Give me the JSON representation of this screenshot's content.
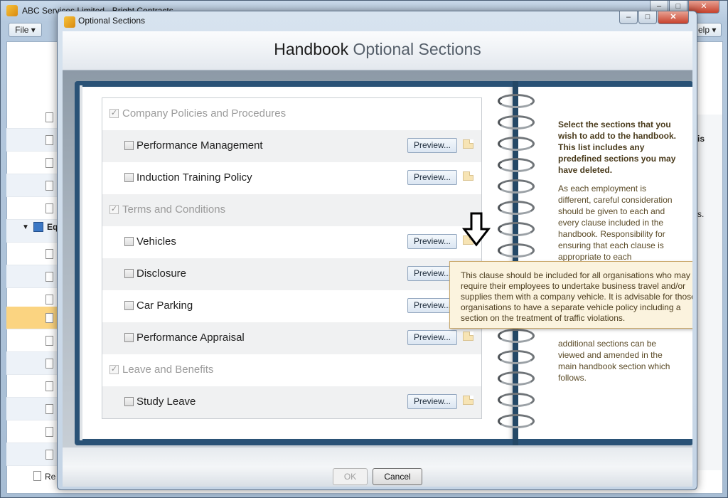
{
  "background_window": {
    "title": "ABC Services Limited - Bright Contracts",
    "file_menu": "File ▾",
    "help_menu": "elp ▾",
    "tree_item_equ": "Equ",
    "tree_item_re": "Re",
    "partial_right_s": "is",
    "partial_right_s2": "s."
  },
  "dialog": {
    "title": "Optional Sections",
    "header": {
      "title_strong": "Handbook",
      "title_light": " Optional Sections"
    },
    "caption_buttons": {
      "minimize": "–",
      "maximize": "□",
      "close": "✕"
    },
    "sections": [
      {
        "label": "Company Policies and Procedures",
        "type": "group",
        "checked": true
      },
      {
        "label": "Performance Management",
        "type": "item",
        "checked": false,
        "preview": "Preview..."
      },
      {
        "label": "Induction Training Policy",
        "type": "item",
        "checked": false,
        "preview": "Preview..."
      },
      {
        "label": "Terms and Conditions",
        "type": "group",
        "checked": true
      },
      {
        "label": "Vehicles",
        "type": "item",
        "checked": false,
        "preview": "Preview..."
      },
      {
        "label": "Disclosure",
        "type": "item",
        "checked": false,
        "preview": "Preview..."
      },
      {
        "label": "Car Parking",
        "type": "item",
        "checked": false,
        "preview": "Preview..."
      },
      {
        "label": "Performance Appraisal",
        "type": "item",
        "checked": false,
        "preview": "Preview..."
      },
      {
        "label": "Leave and Benefits",
        "type": "group",
        "checked": true
      },
      {
        "label": "Study Leave",
        "type": "item",
        "checked": false,
        "preview": "Preview..."
      }
    ],
    "instructions": {
      "bold": "Select the sections that you wish to add to the handbook. This list includes any predefined sections you may have deleted.",
      "body": "As each employment is different, careful consideration should be given to each and every clause included in the handbook. Responsibility for ensuring that each clause is appropriate to each employment rests with the",
      "tail": "additional sections can be viewed and amended in the main handbook section which follows."
    },
    "tooltip": "This clause should be included for all organisations who may require their employees to undertake business travel and/or supplies them with a company vehicle. It is advisable for those organisations to have a separate vehicle policy including a section on the treatment of traffic violations.",
    "buttons": {
      "ok": "OK",
      "cancel": "Cancel"
    }
  },
  "colors": {
    "book_cover": "#2a5276",
    "tooltip_bg": "#fbf3de",
    "selected_row": "#fbd481"
  },
  "icons": {
    "app": "app-logo-icon",
    "note": "note-icon",
    "cursor": "arrow-down-cursor-icon"
  }
}
